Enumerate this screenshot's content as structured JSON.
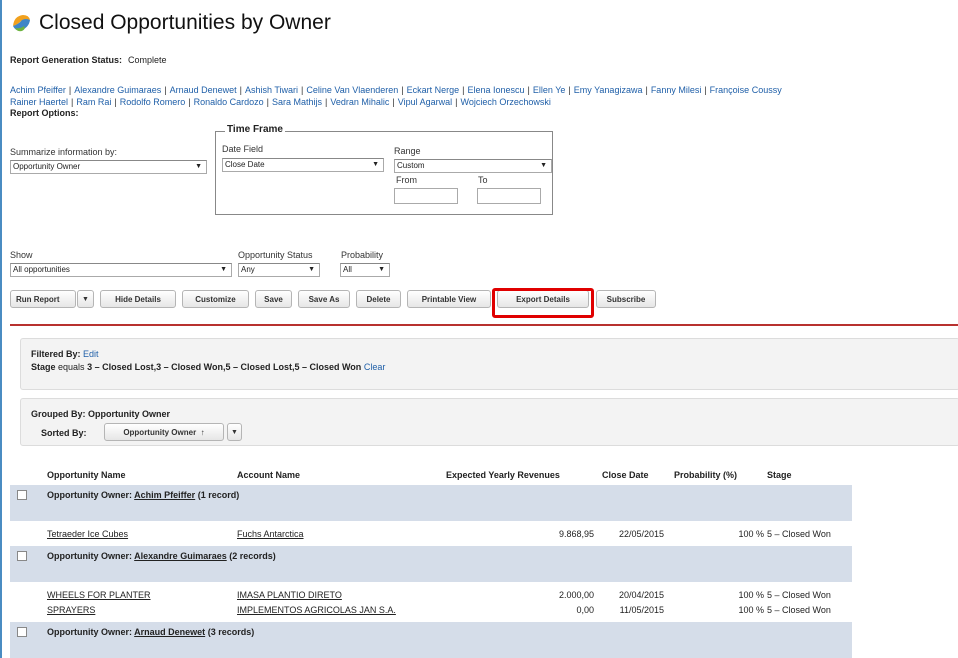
{
  "header": {
    "title": "Closed Opportunities by Owner"
  },
  "status": {
    "label": "Report Generation Status:",
    "value": "Complete"
  },
  "owners": [
    "Achim Pfeiffer",
    "Alexandre Guimaraes",
    "Arnaud Denewet",
    "Ashish Tiwari",
    "Celine Van Vlaenderen",
    "Eckart Nerge",
    "Elena Ionescu",
    "Ellen Ye",
    "Emy Yanagizawa",
    "Fanny Milesi",
    "Françoise Coussy",
    "Rainer Haertel",
    "Ram Rai",
    "Rodolfo Romero",
    "Ronaldo Cardozo",
    "Sara Mathijs",
    "Vedran Mihalic",
    "Vipul Agarwal",
    "Wojciech Orzechowski"
  ],
  "options": {
    "label": "Report Options:",
    "summarize_label": "Summarize information by:",
    "summarize_value": "Opportunity Owner",
    "timeframe": {
      "legend": "Time Frame",
      "date_field_label": "Date Field",
      "date_field_value": "Close Date",
      "range_label": "Range",
      "range_value": "Custom",
      "from_label": "From",
      "to_label": "To"
    },
    "show_label": "Show",
    "show_value": "All opportunities",
    "status_label": "Opportunity Status",
    "status_value": "Any",
    "probability_label": "Probability",
    "probability_value": "All"
  },
  "toolbar": {
    "run_report": "Run Report",
    "hide_details": "Hide Details",
    "customize": "Customize",
    "save": "Save",
    "save_as": "Save As",
    "delete": "Delete",
    "printable_view": "Printable View",
    "export_details": "Export Details",
    "subscribe": "Subscribe"
  },
  "filter": {
    "label": "Filtered By:",
    "edit": "Edit",
    "field": "Stage",
    "operator": "equals",
    "value": "3 – Closed Lost,3 – Closed Won,5 – Closed Lost,5 – Closed Won",
    "clear": "Clear"
  },
  "grouping": {
    "grouped_label": "Grouped By:",
    "grouped_value": "Opportunity Owner",
    "sorted_label": "Sorted By:",
    "sorted_value": "Opportunity Owner"
  },
  "table": {
    "columns": [
      "Opportunity Name",
      "Account Name",
      "Expected Yearly Revenues",
      "Close Date",
      "Probability (%)",
      "Stage"
    ],
    "group_prefix": "Opportunity Owner:",
    "groups": [
      {
        "owner": "Achim Pfeiffer",
        "count": "(1 record)",
        "rows": [
          [
            "Tetraeder Ice Cubes",
            "Fuchs Antarctica",
            "9.868,95",
            "22/05/2015",
            "100 %",
            "5 – Closed Won"
          ]
        ]
      },
      {
        "owner": "Alexandre Guimaraes",
        "count": "(2 records)",
        "rows": [
          [
            "WHEELS FOR PLANTER",
            "IMASA PLANTIO DIRETO",
            "2.000,00",
            "20/04/2015",
            "100 %",
            "5 – Closed Won"
          ],
          [
            "SPRAYERS",
            "IMPLEMENTOS AGRICOLAS JAN S.A.",
            "0,00",
            "11/05/2015",
            "100 %",
            "5 – Closed Won"
          ]
        ]
      },
      {
        "owner": "Arnaud Denewet",
        "count": "(3 records)",
        "rows": []
      }
    ]
  }
}
